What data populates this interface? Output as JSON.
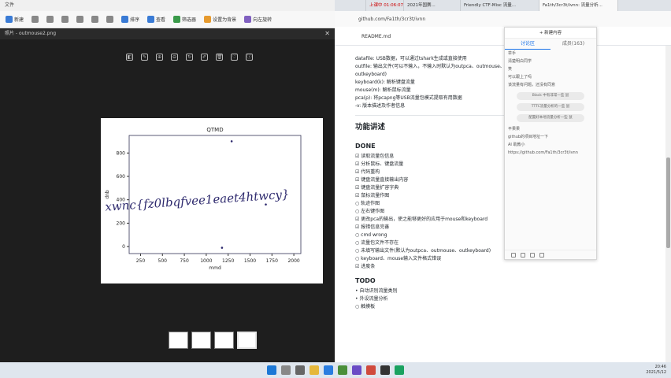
{
  "file_manager": {
    "title": "文件",
    "toolbar": [
      "新建",
      "排序",
      "查看",
      "筛选器",
      "设置为背景",
      "向左旋转"
    ]
  },
  "viewer": {
    "title": "照片 - outmouse2.png",
    "tools": [
      "◧",
      "✎",
      "⊕",
      "⊖",
      "↻",
      "✐",
      "🗑",
      "♡",
      "ⓘ"
    ],
    "figure": {
      "title": "QTMD",
      "xlabel": "mmd",
      "ylabel": "dnb"
    }
  },
  "chart_data": {
    "type": "scatter",
    "title": "QTMD",
    "xlabel": "mmd",
    "ylabel": "dnb",
    "xticks": [
      250,
      500,
      750,
      1000,
      1250,
      1500,
      1750,
      2000
    ],
    "yticks": [
      0,
      200,
      400,
      600,
      800
    ],
    "xlim": [
      120,
      2080
    ],
    "ylim": [
      -60,
      950
    ],
    "annotation": "xwnc{fz0lbqfvee1eaet4htwcy}",
    "points": [
      {
        "x": 1290,
        "y": 900
      },
      {
        "x": 1180,
        "y": -10
      },
      {
        "x": 1680,
        "y": 360
      }
    ]
  },
  "browser": {
    "tabs": [
      "上课中 01:06:07",
      "2021年国赛...",
      "Friendly CTF-Misc 流量...",
      "Fa1th/3cr3t/ivnn: 流量分析...",
      ""
    ],
    "address": "github.com/Fa1th/3cr3t/ivnn",
    "file": "README.md"
  },
  "readme": {
    "options": [
      "datafile: USB数据，可以通过tshark生成或直接使用",
      "outfile: 输出文件(可以不输入，不输入时默认为outpca、outmouse、",
      "outkeyboard)",
      "keyboard(k): 解析键盘流量",
      "mouse(m): 解析鼠标流量",
      "pca(p): 将pcapng等USB流量包模式提取有用数据",
      "-v: 版本描述及作者信息"
    ],
    "section": "功能讲述",
    "done_title": "DONE",
    "done_items": [
      "☑ 读取流量包信息",
      "☑ 分析鼠标、键盘流量",
      "☑ 代码重构",
      "☑ 键盘流量直接输出内容",
      "☑ 键盘流量扩容字典",
      "☑ 鼠标流量作图",
      "     ○ 轨迹作图",
      "     ○ 左右键作图",
      "☑ 更改pca的输出，使之能够更好的应用于mouse和keyboard",
      "☑ 报错信息完善",
      "     ○ cmd wrong",
      "     ○ 流量包文件不存在",
      "     ○ 未填写输出文件(默认为outpca、outmouse、outkeyboard)",
      "     ○ keyboard、mouse输入文件格式错误",
      "☑ 进度条"
    ],
    "todo_title": "TODO",
    "todo_items": [
      "• 自动识别流量类别",
      "• 外设流量分析",
      "     ○ 触摸板"
    ]
  },
  "chat_panel": {
    "top": "+ 新建内容",
    "tabs": [
      "讨论区",
      "成员(163)"
    ],
    "messages": [
      "举手",
      "清楚明白同学",
      "笑",
      "可以跟上了吗",
      "该流量有问题，还没有同意"
    ],
    "pills": [
      "Black 中有非常一些 鼠",
      "TTTC流量分析的一些 鼠",
      "配置好本地流量分析一些 鼠"
    ],
    "more": [
      "平果果",
      "github的项目地址一下",
      "AI 助教小",
      "https://github.com/Fa1th/3cr3t/ivnn"
    ]
  },
  "taskbar": {
    "time": "20:46",
    "date": "2021/5/12"
  }
}
